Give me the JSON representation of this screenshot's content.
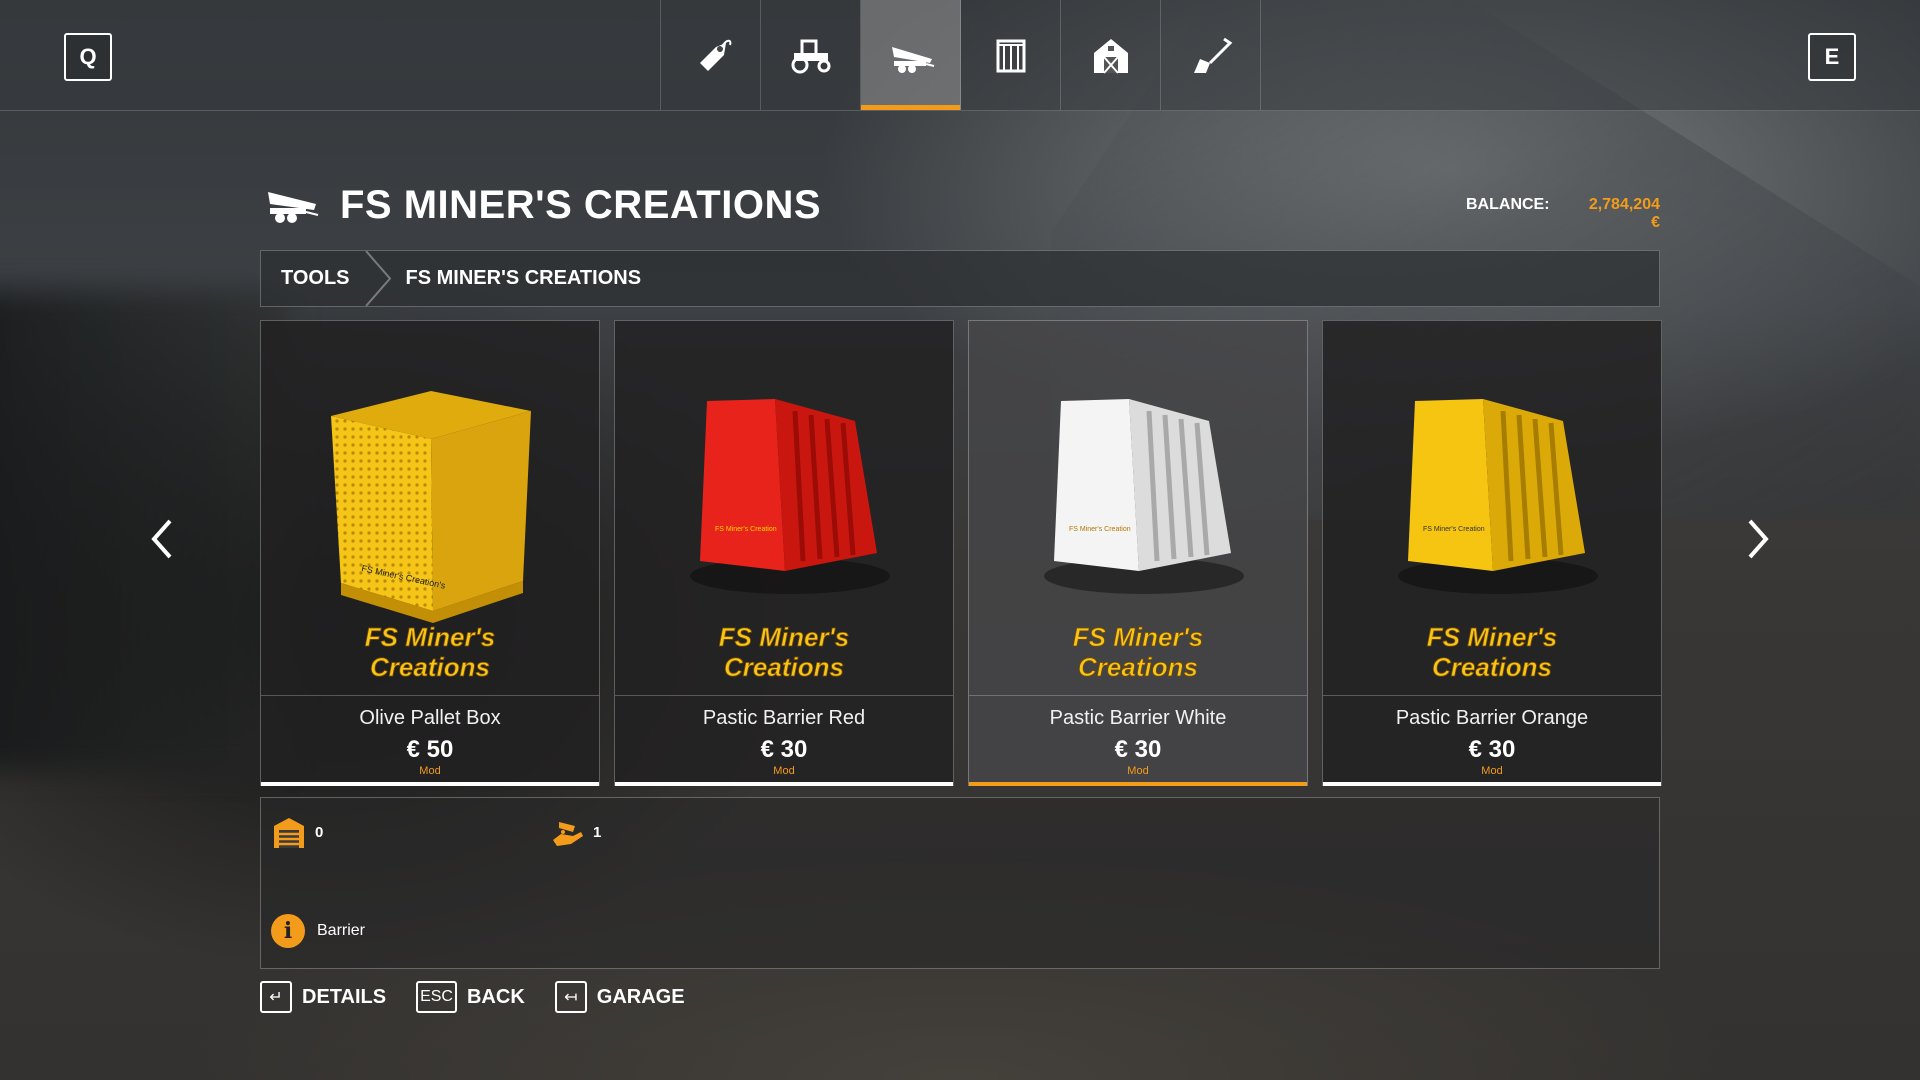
{
  "topbar": {
    "left_key": "Q",
    "right_key": "E",
    "tabs": [
      {
        "icon": "tag-icon",
        "active": false
      },
      {
        "icon": "tractor-icon",
        "active": false
      },
      {
        "icon": "tipper-trailer-icon",
        "active": true
      },
      {
        "icon": "pallet-crate-icon",
        "active": false
      },
      {
        "icon": "barn-icon",
        "active": false
      },
      {
        "icon": "shovel-icon",
        "active": false
      }
    ]
  },
  "header": {
    "icon": "tipper-trailer-icon",
    "title": "FS MINER'S CREATIONS",
    "balance_label": "BALANCE:",
    "balance_value": "2,784,204 €"
  },
  "breadcrumb": {
    "items": [
      "TOOLS",
      "FS MINER'S CREATIONS"
    ]
  },
  "products": [
    {
      "name": "Olive Pallet Box",
      "price": "€ 50",
      "badge": "Mod",
      "brand_line1": "FS Miner's",
      "brand_line2": "Creations",
      "color": "#f5c518",
      "selected": false
    },
    {
      "name": "Pastic Barrier Red",
      "price": "€ 30",
      "badge": "Mod",
      "brand_line1": "FS Miner's",
      "brand_line2": "Creations",
      "color": "#e8231c",
      "selected": false
    },
    {
      "name": "Pastic Barrier White",
      "price": "€ 30",
      "badge": "Mod",
      "brand_line1": "FS Miner's",
      "brand_line2": "Creations",
      "color": "#f4f4f4",
      "selected": true
    },
    {
      "name": "Pastic Barrier Orange",
      "price": "€ 30",
      "badge": "Mod",
      "brand_line1": "FS Miner's",
      "brand_line2": "Creations",
      "color": "#f6c512",
      "selected": false
    }
  ],
  "info": {
    "owned_count": "0",
    "leased_count": "1",
    "description": "Barrier"
  },
  "actions": [
    {
      "key": "↵",
      "label": "DETAILS"
    },
    {
      "key": "ESC",
      "label": "BACK"
    },
    {
      "key": "↤",
      "label": "GARAGE"
    }
  ],
  "colors": {
    "accent": "#f39c1b"
  }
}
